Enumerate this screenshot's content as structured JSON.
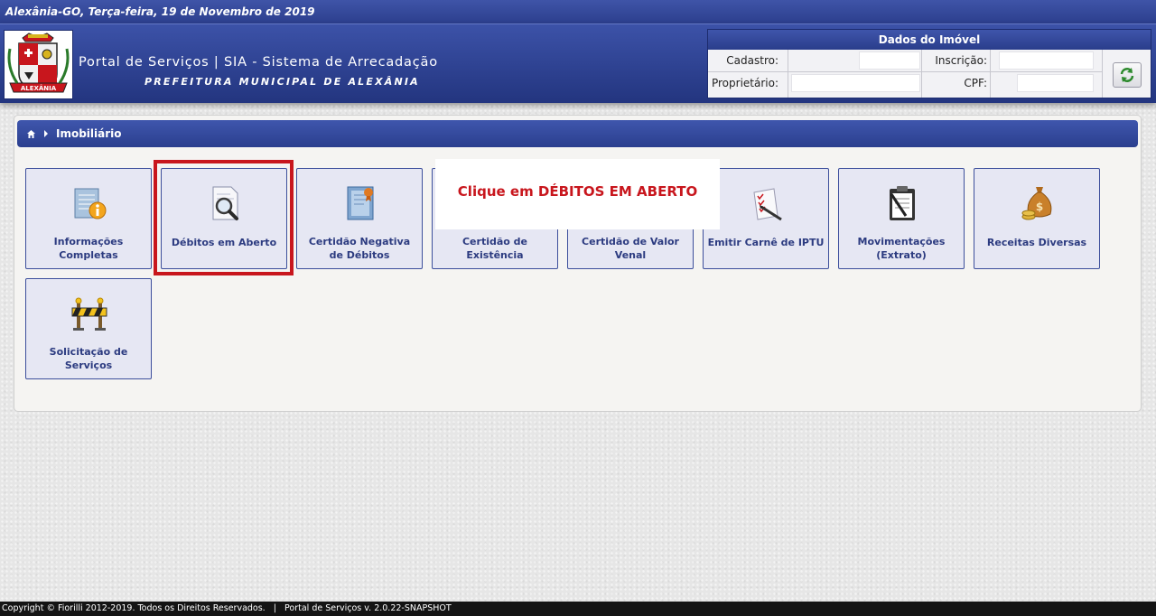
{
  "topbar": {
    "date_text": "Alexânia-GO, Terça-feira, 19 de Novembro de 2019"
  },
  "header": {
    "title": "Portal de Serviços | SIA - Sistema de Arrecadação",
    "subtitle": "PREFEITURA MUNICIPAL DE ALEXÂNIA",
    "logo_text": "ALEXÂNIA"
  },
  "imovel": {
    "heading": "Dados do Imóvel",
    "cadastro_label": "Cadastro:",
    "inscricao_label": "Inscrição:",
    "proprietario_label": "Proprietário:",
    "cpf_label": "CPF:",
    "cadastro_value": "",
    "inscricao_value": "",
    "proprietario_value": "",
    "cpf_value": ""
  },
  "breadcrumb": {
    "section": "Imobiliário"
  },
  "tiles": [
    {
      "label": "Informações Completas",
      "icon": "info-document-icon"
    },
    {
      "label": "Débitos em Aberto",
      "icon": "magnifier-document-icon"
    },
    {
      "label": "Certidão Negativa de Débitos",
      "icon": "certificate-icon"
    },
    {
      "label": "Certidão de Existência",
      "icon": "certificate-icon"
    },
    {
      "label": "Certidão de Valor Venal",
      "icon": "certificate-icon"
    },
    {
      "label": "Emitir Carnê de IPTU",
      "icon": "checklist-pen-icon"
    },
    {
      "label": "Movimentações (Extrato)",
      "icon": "clipboard-icon"
    },
    {
      "label": "Receitas Diversas",
      "icon": "money-bag-icon"
    },
    {
      "label": "Solicitação de Serviços",
      "icon": "roadblock-icon"
    }
  ],
  "callout": {
    "text": "Clique em DÉBITOS EM ABERTO"
  },
  "footer": {
    "text": "Copyright © Fiorilli 2012-2019. Todos os Direitos Reservados.   |   Portal de Serviços v. 2.0.22-SNAPSHOT"
  },
  "colors": {
    "brand_blue": "#2c3f8e",
    "highlight_red": "#c8161d",
    "tile_bg": "#e6e7f3"
  }
}
